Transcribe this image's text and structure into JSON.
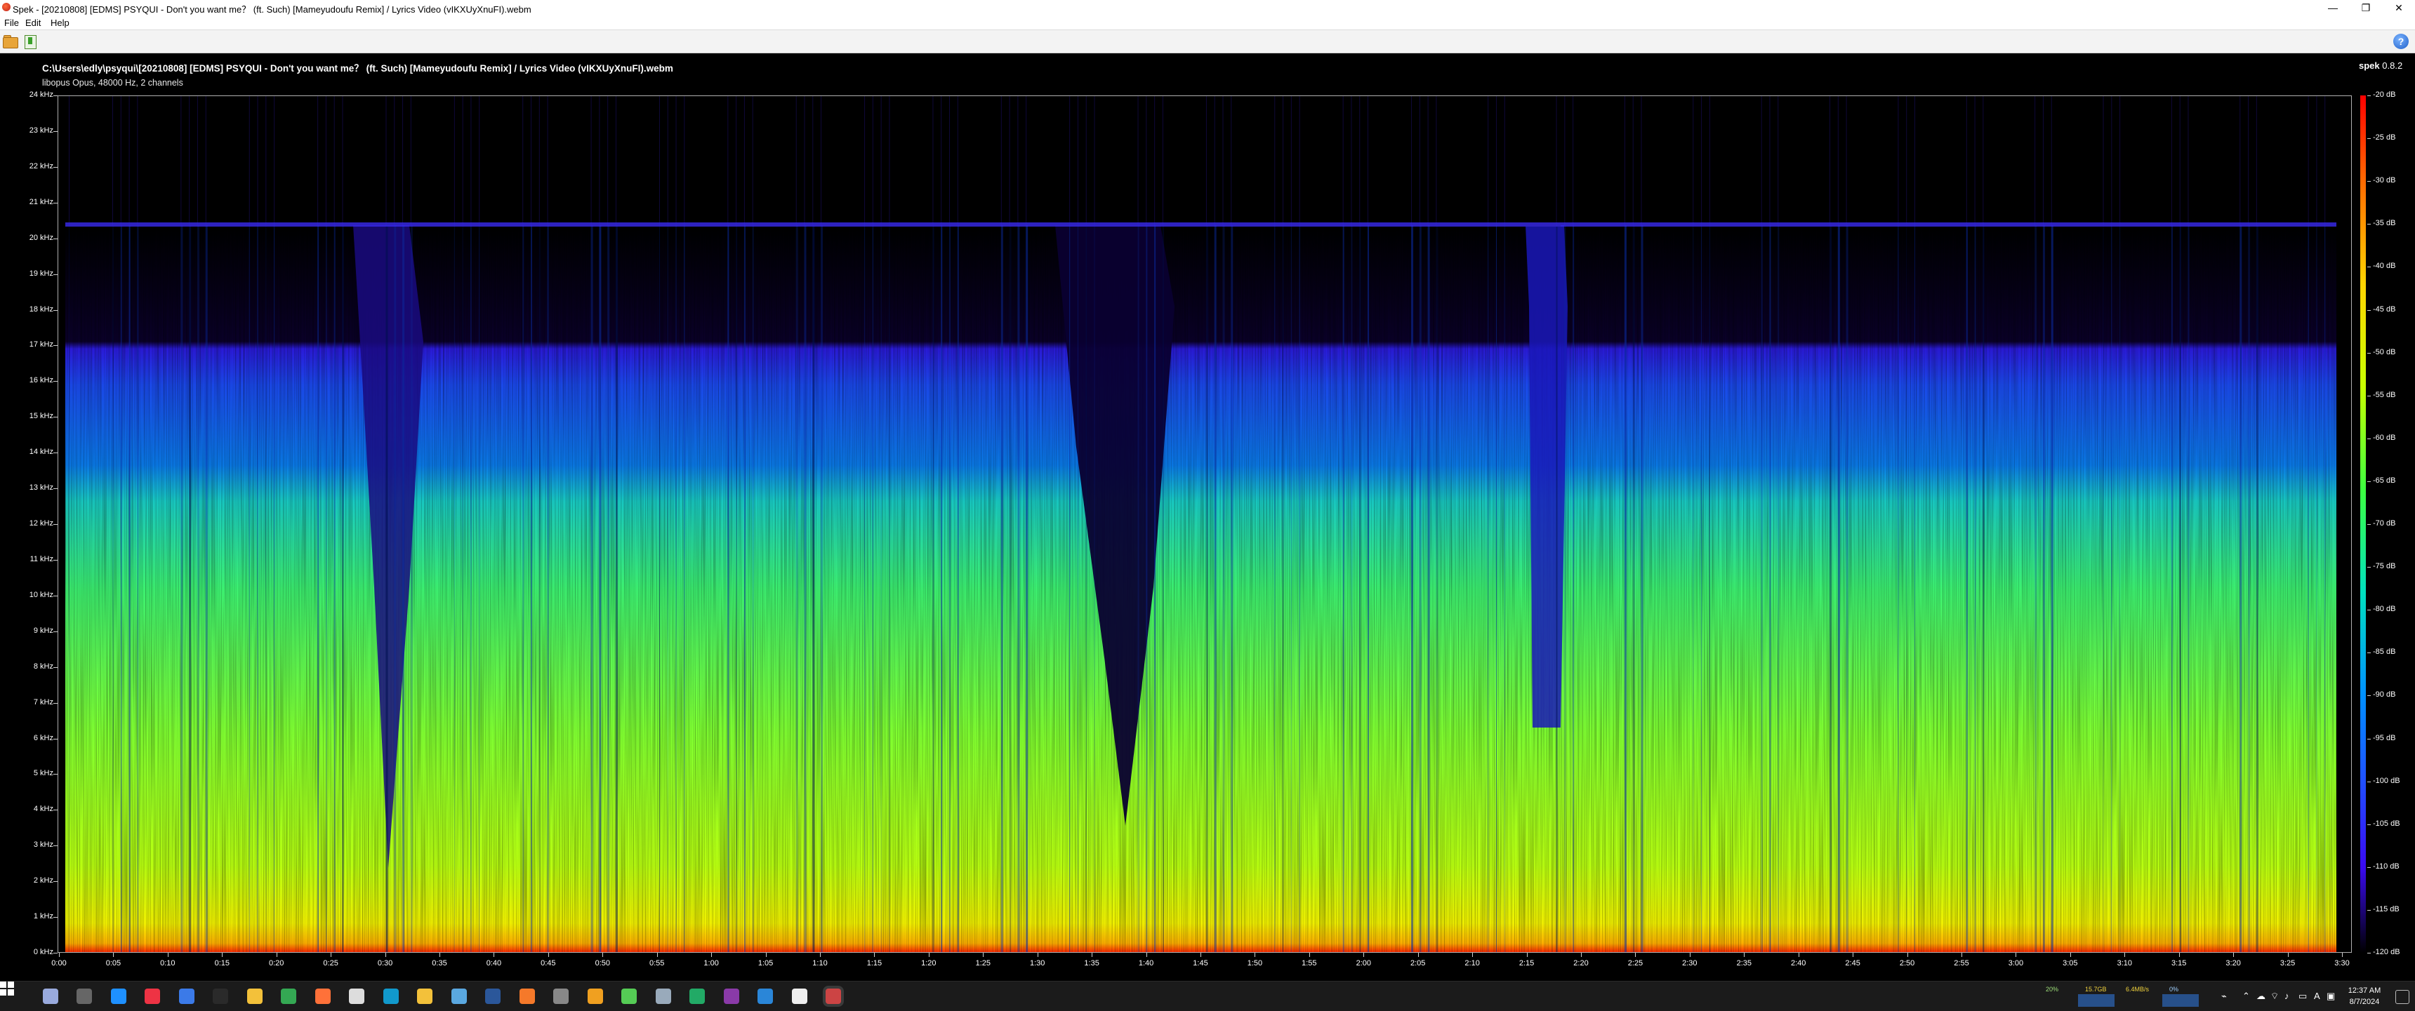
{
  "window": {
    "title": "Spek - [20210808] [EDMS] PSYQUI - Don't you want me？ (ft. Such) [Mameyudoufu Remix] / Lyrics Video (vIKXUyXnuFI).webm",
    "controls": [
      "—",
      "❐",
      "✕"
    ]
  },
  "menu": {
    "file": "File",
    "edit": "Edit",
    "help": "Help"
  },
  "toolbar": {
    "open": "folder-open-icon",
    "save": "save-icon",
    "about": "?"
  },
  "header": {
    "file_path": "C:\\Users\\edly\\psyqui\\[20210808] [EDMS] PSYQUI - Don't you want me？ (ft. Such) [Mameyudoufu Remix] / Lyrics Video (vIKXUyXnuFI).webm",
    "audio_info": "libopus Opus, 48000 Hz, 2 channels",
    "brand_name": "spek",
    "brand_version": "0.8.2"
  },
  "spectrogram": {
    "y_axis_labels": [
      "0 kHz",
      "1 kHz",
      "2 kHz",
      "3 kHz",
      "4 kHz",
      "5 kHz",
      "6 kHz",
      "7 kHz",
      "8 kHz",
      "9 kHz",
      "10 kHz",
      "11 kHz",
      "12 kHz",
      "13 kHz",
      "14 kHz",
      "15 kHz",
      "16 kHz",
      "17 kHz",
      "18 kHz",
      "19 kHz",
      "20 kHz",
      "21 kHz",
      "22 kHz",
      "23 kHz",
      "24 kHz"
    ],
    "x_axis_labels": [
      "0:00",
      "0:05",
      "0:10",
      "0:15",
      "0:20",
      "0:25",
      "0:30",
      "0:35",
      "0:40",
      "0:45",
      "0:50",
      "0:55",
      "1:00",
      "1:05",
      "1:10",
      "1:15",
      "1:20",
      "1:25",
      "1:30",
      "1:35",
      "1:40",
      "1:45",
      "1:50",
      "1:55",
      "2:00",
      "2:05",
      "2:10",
      "2:15",
      "2:20",
      "2:25",
      "2:30",
      "2:35",
      "2:40",
      "2:45",
      "2:50",
      "2:55",
      "3:00",
      "3:05",
      "3:10",
      "3:15",
      "3:20",
      "3:25",
      "3:30"
    ],
    "db_labels": [
      "-20 dB",
      "-25 dB",
      "-30 dB",
      "-35 dB",
      "-40 dB",
      "-45 dB",
      "-50 dB",
      "-55 dB",
      "-60 dB",
      "-65 dB",
      "-70 dB",
      "-75 dB",
      "-80 dB",
      "-85 dB",
      "-90 dB",
      "-95 dB",
      "-100 dB",
      "-105 dB",
      "-110 dB",
      "-115 dB",
      "-120 dB"
    ],
    "colors": {
      "peak": "#ff0000",
      "high": "#ffd400",
      "mid": "#3cff40",
      "low": "#0090ff",
      "floor": "#3a0af0"
    }
  },
  "taskbar": {
    "icons": [
      "start-icon",
      "search-icon",
      "task-view-icon",
      "cortana-icon",
      "app-red-icon",
      "app-blue-icon",
      "terminal-icon",
      "explorer-icon",
      "chrome-icon",
      "firefox-icon",
      "unity-icon",
      "app-cyan-icon",
      "folder-icon",
      "notepad-icon",
      "word-icon",
      "blender-icon",
      "settings-icon",
      "search-tool-icon",
      "notes-icon",
      "drive-icon",
      "calculator-icon",
      "obs-icon",
      "vscode-icon",
      "window-icon",
      "spek-icon"
    ],
    "perf": {
      "cpu": "20%",
      "ram": "15.7GB",
      "net": "6.4MB/s",
      "gpu": "0%"
    },
    "time": "12:37 AM",
    "date": "8/7/2024"
  }
}
